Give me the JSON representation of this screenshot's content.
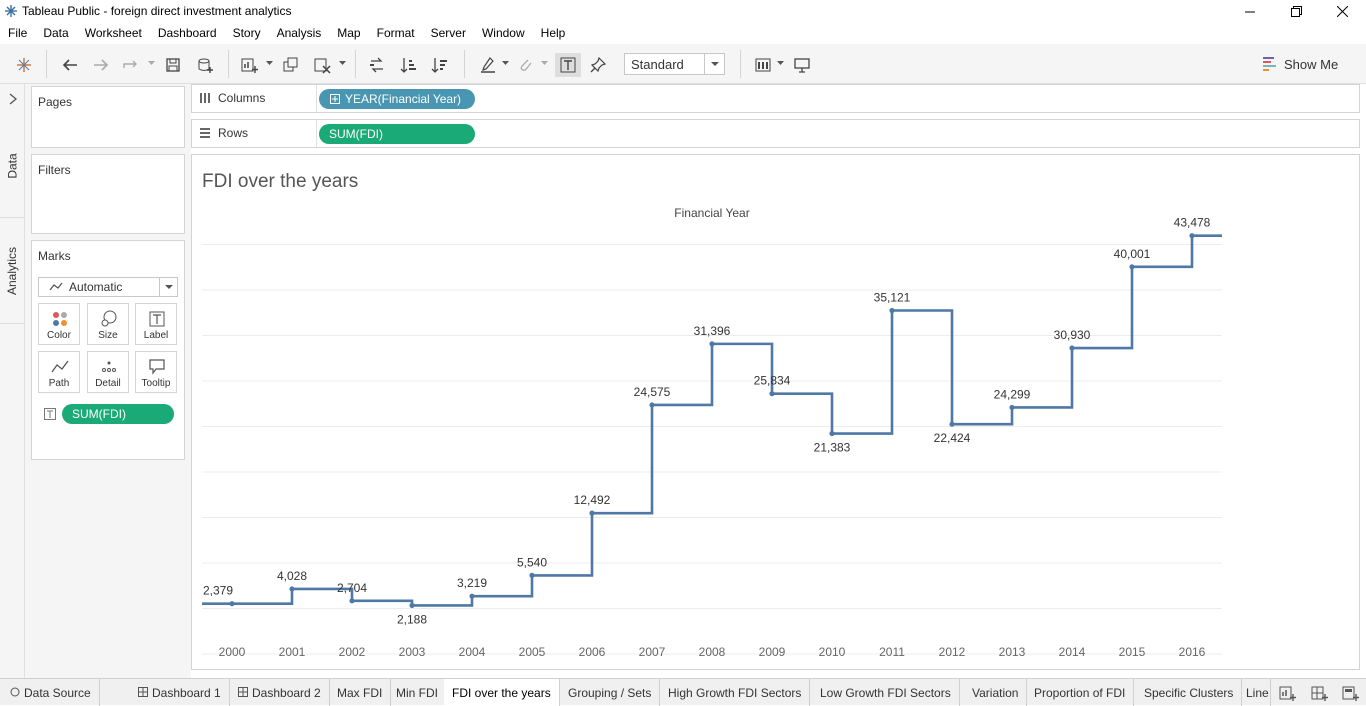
{
  "window": {
    "title": "Tableau Public - foreign direct investment analytics"
  },
  "menu": [
    "File",
    "Data",
    "Worksheet",
    "Dashboard",
    "Story",
    "Analysis",
    "Map",
    "Format",
    "Server",
    "Window",
    "Help"
  ],
  "toolbar": {
    "fit_value": "Standard",
    "show_me_label": "Show Me"
  },
  "rail": {
    "data_tab": "Data",
    "analytics_tab": "Analytics"
  },
  "panels": {
    "pages": "Pages",
    "filters": "Filters",
    "marks": "Marks",
    "mark_type": "Automatic",
    "mark_buttons": [
      "Color",
      "Size",
      "Label",
      "Path",
      "Detail",
      "Tooltip"
    ],
    "marks_pill": "SUM(FDI)"
  },
  "shelves": {
    "columns_label": "Columns",
    "columns_pill": "YEAR(Financial Year)",
    "rows_label": "Rows",
    "rows_pill": "SUM(FDI)"
  },
  "viz": {
    "title": "FDI over the years"
  },
  "chart_data": {
    "type": "line",
    "line_style": "step",
    "title": "FDI over the years",
    "xlabel": "Financial Year",
    "ylabel": "",
    "x": [
      "2000",
      "2001",
      "2002",
      "2003",
      "2004",
      "2005",
      "2006",
      "2007",
      "2008",
      "2009",
      "2010",
      "2011",
      "2012",
      "2013",
      "2014",
      "2015",
      "2016"
    ],
    "series": [
      {
        "values": [
          2379,
          4028,
          2704,
          2188,
          3219,
          5540,
          12492,
          24575,
          31396,
          25834,
          21383,
          35121,
          22424,
          24299,
          30930,
          40001,
          43478
        ]
      }
    ],
    "labels": [
      "2,379",
      "4,028",
      "2,704",
      "2,188",
      "3,219",
      "5,540",
      "12,492",
      "24,575",
      "31,396",
      "25,834",
      "21,383",
      "35,121",
      "22,424",
      "24,299",
      "30,930",
      "40,001",
      "43,478"
    ],
    "ylim": [
      0,
      44000
    ],
    "grid": true,
    "colors": {
      "line": "#4e79a7",
      "grid": "#ececec"
    }
  },
  "sheet_tabs": [
    "Data Source",
    "Dashboard 1",
    "Dashboard 2",
    "Max FDI",
    "Min FDI",
    "FDI over the years",
    "Grouping / Sets",
    "High Growth FDI Sectors",
    "Low Growth FDI Sectors",
    "Variation",
    "Proportion of FDI",
    "Specific Clusters",
    "Line"
  ],
  "active_tab": "FDI over the years"
}
